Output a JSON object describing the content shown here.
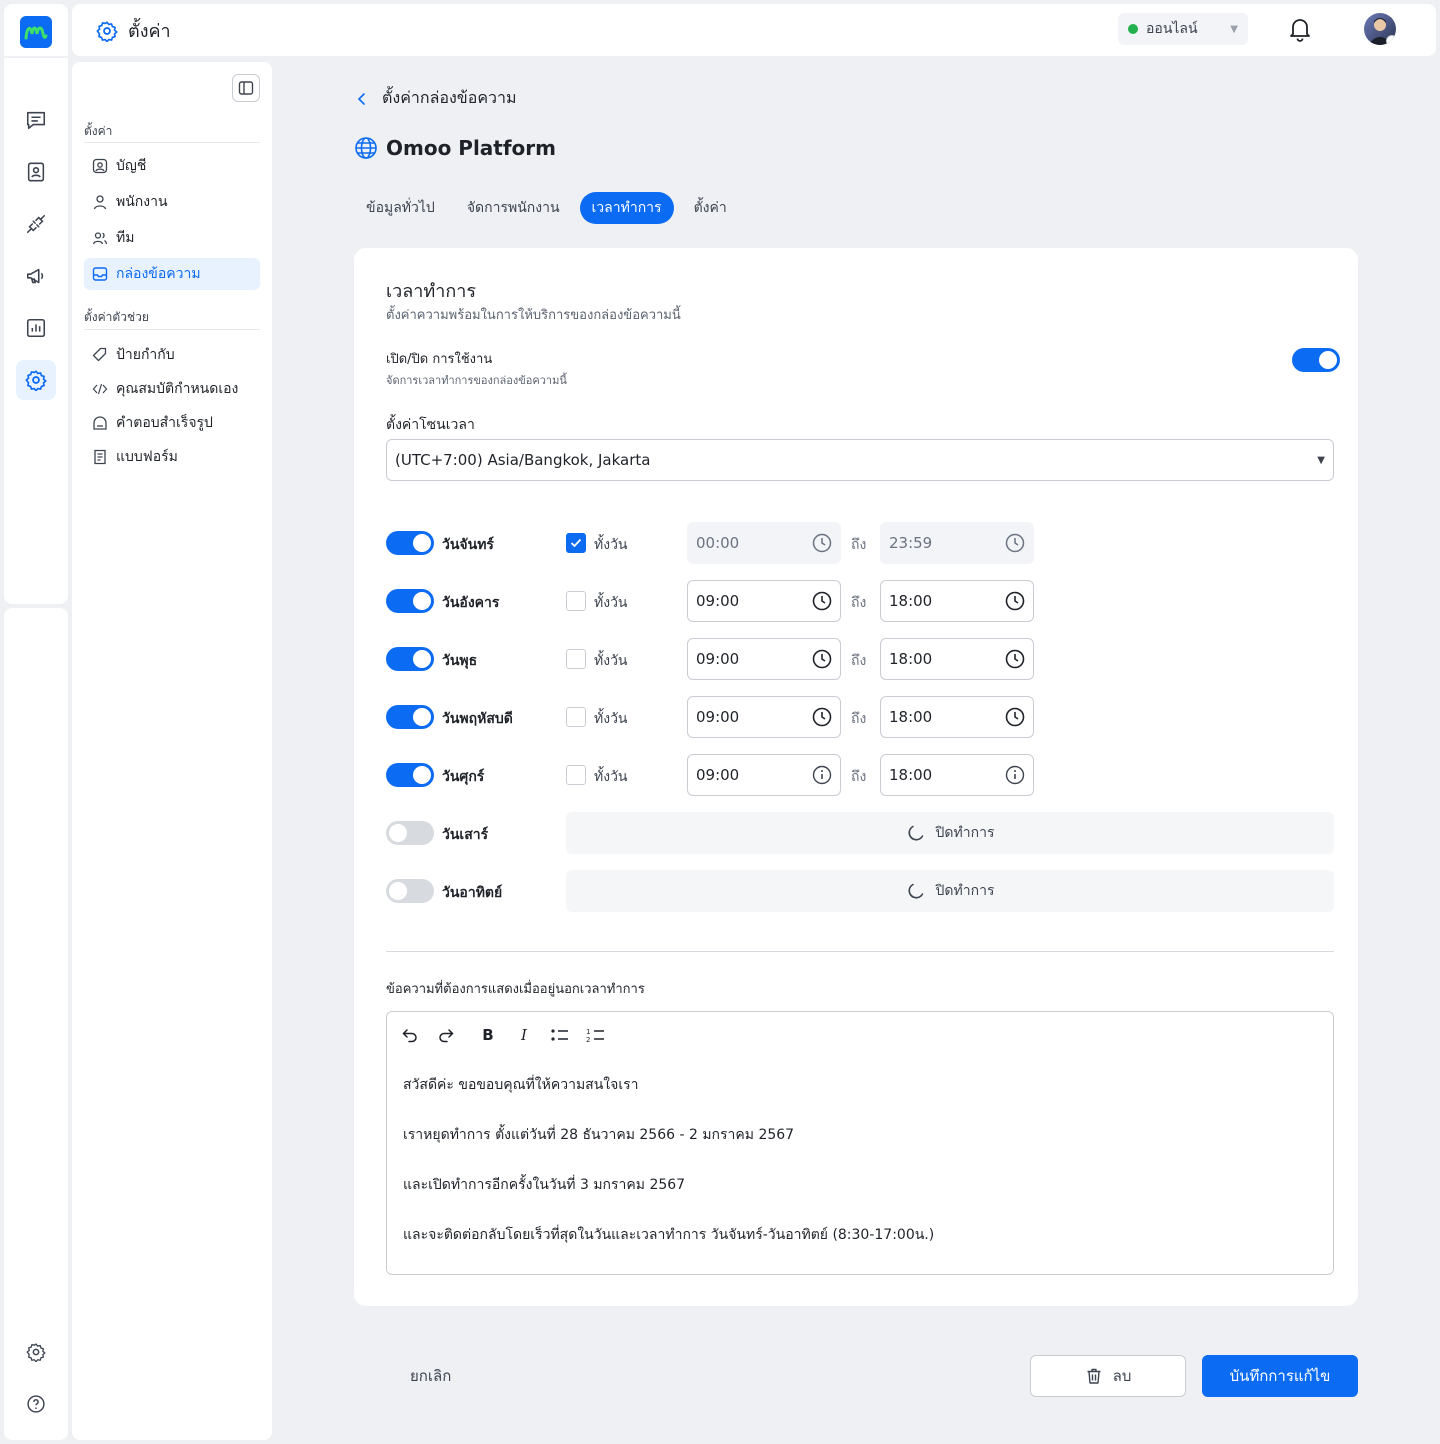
{
  "colors": {
    "accent": "#0b6bf2",
    "online": "#22b14c",
    "muted": "#5c6370"
  },
  "topbar": {
    "title": "ตั้งค่า",
    "title_icon": "gear-icon",
    "status": "ออนไลน์",
    "notification_icon": "bell-icon"
  },
  "rail": {
    "items": [
      {
        "icon": "chat-icon"
      },
      {
        "icon": "contacts-icon"
      },
      {
        "icon": "plug-icon"
      },
      {
        "icon": "megaphone-icon"
      },
      {
        "icon": "chart-icon"
      },
      {
        "icon": "gear-icon",
        "active": true
      }
    ],
    "bottom": [
      {
        "icon": "gear-icon"
      },
      {
        "icon": "help-icon"
      }
    ]
  },
  "sidebar": {
    "section1": "ตั้งค่า",
    "items1": [
      {
        "label": "บัญชี",
        "icon": "account-icon"
      },
      {
        "label": "พนักงาน",
        "icon": "user-icon"
      },
      {
        "label": "ทีม",
        "icon": "team-icon"
      },
      {
        "label": "กล่องข้อความ",
        "icon": "inbox-icon",
        "active": true
      }
    ],
    "section2": "ตั้งค่าตัวช่วย",
    "items2": [
      {
        "label": "ป้ายกำกับ",
        "icon": "tag-icon"
      },
      {
        "label": "คุณสมบัติกำหนดเอง",
        "icon": "code-icon"
      },
      {
        "label": "คำตอบสำเร็จรูป",
        "icon": "canned-response-icon"
      },
      {
        "label": "แบบฟอร์ม",
        "icon": "form-icon"
      }
    ]
  },
  "main": {
    "breadcrumb": "ตั้งค่ากล่องข้อความ",
    "platform": "Omoo Platform",
    "tabs": [
      "ข้อมูลทั่วไป",
      "จัดการพนักงาน",
      "เวลาทำการ",
      "ตั้งค่า"
    ],
    "active_tab": 2
  },
  "card": {
    "title": "เวลาทำการ",
    "subtitle": "ตั้งค่าความพร้อมในการให้บริการของกล่องข้อความนี้",
    "enable_label": "เปิด/ปิด การใช้งาน",
    "enable_sub": "จัดการเวลาทำการของกล่องข้อความนี้",
    "enabled": true,
    "timezone_label": "ตั้งค่าโซนเวลา",
    "timezone_value": "(UTC+7:00) Asia/Bangkok, Jakarta",
    "allday_label": "ทั้งวัน",
    "to_label": "ถึง",
    "closed_label": "ปิดทำการ",
    "days": [
      {
        "name": "วันจันทร์",
        "on": true,
        "allday": true,
        "from": "00:00",
        "to": "23:59",
        "icon": "clock-icon"
      },
      {
        "name": "วันอังคาร",
        "on": true,
        "allday": false,
        "from": "09:00",
        "to": "18:00",
        "icon": "clock-icon"
      },
      {
        "name": "วันพุธ",
        "on": true,
        "allday": false,
        "from": "09:00",
        "to": "18:00",
        "icon": "clock-icon"
      },
      {
        "name": "วันพฤหัสบดี",
        "on": true,
        "allday": false,
        "from": "09:00",
        "to": "18:00",
        "icon": "clock-icon"
      },
      {
        "name": "วันศุกร์",
        "on": true,
        "allday": false,
        "from": "09:00",
        "to": "18:00",
        "icon": "info-icon"
      },
      {
        "name": "วันเสาร์",
        "on": false
      },
      {
        "name": "วันอาทิตย์",
        "on": false
      }
    ],
    "message_label": "ข้อความที่ต้องการแสดงเมื่ออยู่นอกเวลาทำการ",
    "message_lines": [
      "สวัสดีค่ะ ขอขอบคุณที่ให้ความสนใจเรา",
      "เราหยุดทำการ ตั้งแต่วันที่ 28 ธันวาคม 2566 - 2 มกราคม 2567",
      "และเปิดทำการอีกครั้งในวันที่ 3 มกราคม 2567",
      "และจะติดต่อกลับโดยเร็วที่สุดในวันและเวลาทำการ วันจันทร์-วันอาทิตย์ (8:30-17:00น.)"
    ]
  },
  "footer": {
    "cancel": "ยกเลิก",
    "delete": "ลบ",
    "save": "บันทึกการแก้ไข"
  }
}
